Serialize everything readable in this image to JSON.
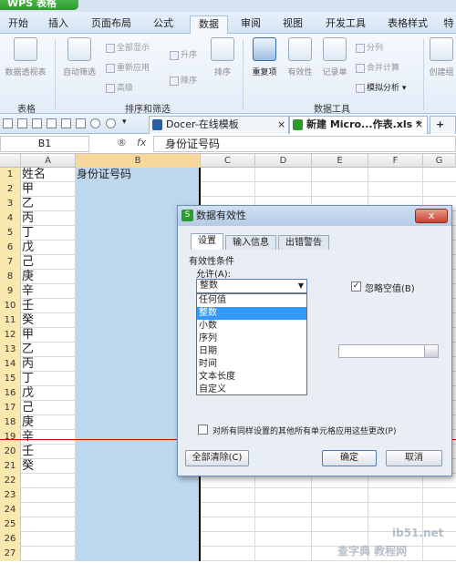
{
  "app": {
    "title": "WPS 表格"
  },
  "menu": {
    "tabs": [
      {
        "label": "开始"
      },
      {
        "label": "插入"
      },
      {
        "label": "页面布局"
      },
      {
        "label": "公式"
      },
      {
        "label": "数据"
      },
      {
        "label": "审阅"
      },
      {
        "label": "视图"
      },
      {
        "label": "开发工具"
      },
      {
        "label": "表格样式"
      },
      {
        "label": "特"
      }
    ]
  },
  "ribbon": {
    "pivot": "数据透视表",
    "autofilter": "自动筛选",
    "show_all": "全部显示",
    "reapply": "重新应用",
    "advanced": "高级",
    "sort_asc": "升序",
    "sort_desc": "降序",
    "sort": "排序",
    "duplicates": "重复项",
    "validity": "有效性",
    "record": "记录单",
    "split": "分列",
    "consolidate": "合并计算",
    "whatif": "模拟分析",
    "create_group": "创建组",
    "group_table": "表格",
    "group_sortfilter": "排序和筛选",
    "group_datatools": "数据工具"
  },
  "doc_tabs": [
    {
      "label": "Docer-在线模板",
      "close": "×"
    },
    {
      "label": "新建 Micro...作表.xls *",
      "close": "×"
    }
  ],
  "add_tab": "+",
  "formula_bar": {
    "cell_ref": "B1",
    "value": "身份证号码"
  },
  "columns": [
    "A",
    "B",
    "C",
    "D",
    "E",
    "F",
    "G"
  ],
  "rows": [
    {
      "n": "1",
      "a": "姓名",
      "b": "身份证号码"
    },
    {
      "n": "2",
      "a": "甲",
      "b": ""
    },
    {
      "n": "3",
      "a": "乙",
      "b": ""
    },
    {
      "n": "4",
      "a": "丙",
      "b": ""
    },
    {
      "n": "5",
      "a": "丁",
      "b": ""
    },
    {
      "n": "6",
      "a": "戊",
      "b": ""
    },
    {
      "n": "7",
      "a": "己",
      "b": ""
    },
    {
      "n": "8",
      "a": "庚",
      "b": ""
    },
    {
      "n": "9",
      "a": "辛",
      "b": ""
    },
    {
      "n": "10",
      "a": "壬",
      "b": ""
    },
    {
      "n": "11",
      "a": "癸",
      "b": ""
    },
    {
      "n": "12",
      "a": "甲",
      "b": ""
    },
    {
      "n": "13",
      "a": "乙",
      "b": ""
    },
    {
      "n": "14",
      "a": "丙",
      "b": ""
    },
    {
      "n": "15",
      "a": "丁",
      "b": ""
    },
    {
      "n": "16",
      "a": "戊",
      "b": ""
    },
    {
      "n": "17",
      "a": "己",
      "b": ""
    },
    {
      "n": "18",
      "a": "庚",
      "b": ""
    },
    {
      "n": "19",
      "a": "辛",
      "b": ""
    },
    {
      "n": "20",
      "a": "壬",
      "b": ""
    },
    {
      "n": "21",
      "a": "癸",
      "b": ""
    },
    {
      "n": "22",
      "a": "",
      "b": ""
    },
    {
      "n": "23",
      "a": "",
      "b": ""
    },
    {
      "n": "24",
      "a": "",
      "b": ""
    },
    {
      "n": "25",
      "a": "",
      "b": ""
    },
    {
      "n": "26",
      "a": "",
      "b": ""
    },
    {
      "n": "27",
      "a": "",
      "b": ""
    }
  ],
  "dialog": {
    "title": "数据有效性",
    "close": "x",
    "tabs": [
      "设置",
      "输入信息",
      "出错警告"
    ],
    "criteria_label": "有效性条件",
    "allow_label": "允许(A):",
    "allow_value": "整数",
    "ignore_blank": "忽略空值(B)",
    "options": [
      "任何值",
      "整数",
      "小数",
      "序列",
      "日期",
      "时间",
      "文本长度",
      "自定义"
    ],
    "selected_option": "整数",
    "apply_all": "对所有同样设置的其他所有单元格应用这些更改(P)",
    "clear_all": "全部清除(C)",
    "ok": "确定",
    "cancel": "取消"
  },
  "watermark": {
    "line1": "ib51.net",
    "line2": "查字典 教程网"
  }
}
